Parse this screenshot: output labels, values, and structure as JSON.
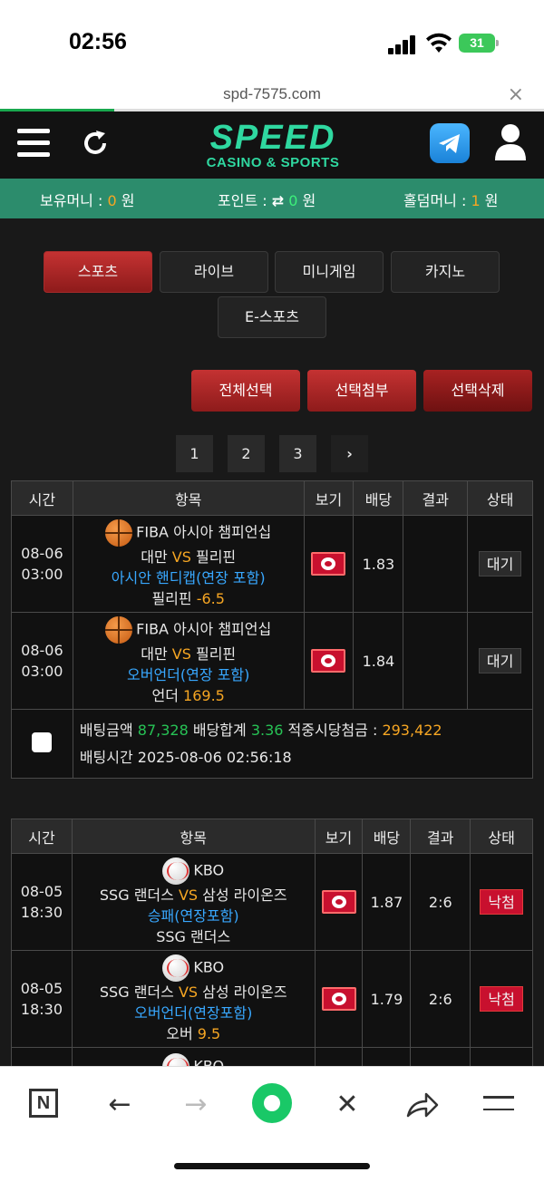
{
  "status_bar": {
    "time": "02:56",
    "battery": "31"
  },
  "browser": {
    "url": "spd-7575.com",
    "close_label": "×",
    "progress": 0.21
  },
  "header": {
    "logo_main": "SPEED",
    "logo_sub": "CASINO & SPORTS",
    "icons": [
      "hamburger-menu-icon",
      "refresh-icon",
      "telegram-icon",
      "user-icon"
    ]
  },
  "money": {
    "holding_label": "보유머니 : ",
    "holding_value": "0",
    "holding_unit": " 원",
    "point_label": "포인트 : ",
    "point_swap": "⇄",
    "point_value": "0",
    "point_unit": " 원",
    "holdem_label": "홀덤머니 : ",
    "holdem_value": "1",
    "holdem_unit": " 원"
  },
  "tabs": [
    "스포츠",
    "라이브",
    "미니게임",
    "카지노",
    "E-스포츠"
  ],
  "actions": {
    "select_all": "전체선택",
    "select_attach": "선택첨부",
    "select_delete": "선택삭제"
  },
  "pagination": {
    "pages": [
      "1",
      "2",
      "3"
    ],
    "next": "›"
  },
  "bet1": {
    "headers": [
      "시간",
      "항목",
      "보기",
      "배당",
      "결과",
      "상태"
    ],
    "rows": [
      {
        "date": "08-06",
        "time": "03:00",
        "league": "FIBA 아시아 챔피언십",
        "home": "대만",
        "vs": "VS",
        "away": "필리핀",
        "market": "아시안 핸디캡(연장 포함)",
        "pick": "필리핀",
        "pick_value": "-6.5",
        "odds": "1.83",
        "result": "",
        "status": "대기"
      },
      {
        "date": "08-06",
        "time": "03:00",
        "league": "FIBA 아시아 챔피언십",
        "home": "대만",
        "vs": "VS",
        "away": "필리핀",
        "market": "오버언더(연장 포함)",
        "pick": "언더",
        "pick_value": "169.5",
        "odds": "1.84",
        "result": "",
        "status": "대기"
      }
    ],
    "summary": {
      "amount_label": "배팅금액 ",
      "amount": "87,328",
      "total_label": " 배당합계 ",
      "total": "3.36",
      "win_label": " 적중시당첨금 : ",
      "win": "293,422",
      "time_label": "배팅시간 ",
      "time": "2025-08-06 02:56:18"
    }
  },
  "bet2": {
    "headers": [
      "시간",
      "항목",
      "보기",
      "배당",
      "결과",
      "상태"
    ],
    "rows": [
      {
        "date": "08-05",
        "time": "18:30",
        "league": "KBO",
        "home": "SSG 랜더스",
        "vs": "VS",
        "away": "삼성 라이온즈",
        "market": "승패(연장포함)",
        "pick": "SSG 랜더스",
        "pick_value": "",
        "odds": "1.87",
        "result": "2:6",
        "status": "낙첨"
      },
      {
        "date": "08-05",
        "time": "18:30",
        "league": "KBO",
        "home": "SSG 랜더스",
        "vs": "VS",
        "away": "삼성 라이온즈",
        "market": "오버언더(연장포함)",
        "pick": "오버",
        "pick_value": "9.5",
        "odds": "1.79",
        "result": "2:6",
        "status": "낙첨"
      },
      {
        "league": "KBO"
      }
    ]
  },
  "bottom_bar": {
    "n_label": "N",
    "back": "←",
    "forward": "→",
    "close": "✕"
  }
}
